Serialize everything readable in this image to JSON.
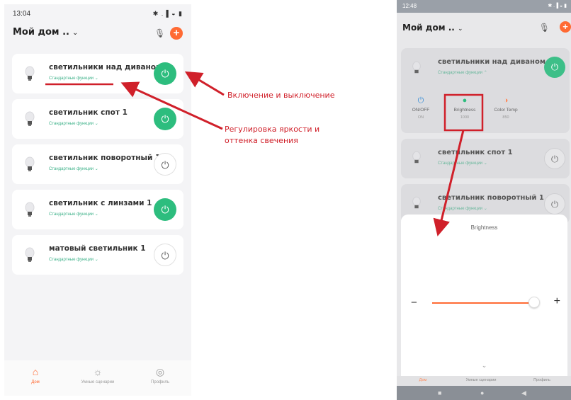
{
  "left_phone": {
    "status_time": "13:04",
    "status_icons": "✱ .▐ ◒ ▮",
    "home_title": "Мой дом ..",
    "devices": [
      {
        "name": "светильники над диваном",
        "func": "Стандартные функции ⌄",
        "state": "on"
      },
      {
        "name": "светильник спот 1",
        "func": "Стандартные функции ⌄",
        "state": "on"
      },
      {
        "name": "светильник поворотный 1",
        "func": "Стандартные функции ⌄",
        "state": "off"
      },
      {
        "name": "светильник с линзами 1",
        "func": "Стандартные функции ⌄",
        "state": "on"
      },
      {
        "name": "матовый светильник 1",
        "func": "Стандартные функции ⌄",
        "state": "off"
      }
    ],
    "tabs": [
      {
        "label": "Дом",
        "icon": "home-icon",
        "active": true
      },
      {
        "label": "Умные сценарии",
        "icon": "sun-icon",
        "active": false
      },
      {
        "label": "Профиль",
        "icon": "profile-icon",
        "active": false
      }
    ]
  },
  "annotations": {
    "power_label": "Включение и выключение",
    "brightness_label_line1": "Регулировка яркости и",
    "brightness_label_line2": "оттенка свечения"
  },
  "right_phone": {
    "status_time": "12:48",
    "status_icons": "✱ .▐ ◒ ▮",
    "home_title": "Мой дом ..",
    "devices": [
      {
        "name": "светильники над диваном",
        "func": "Стандартные функции ⌃",
        "state": "on"
      },
      {
        "name": "светильник спот 1",
        "func": "Стандартные функции ⌄",
        "state": "off"
      },
      {
        "name": "светильник поворотный 1",
        "func": "Стандартные функции ⌄",
        "state": "off"
      }
    ],
    "controls": [
      {
        "label": "ON/OFF",
        "value": "ON"
      },
      {
        "label": "Brightness",
        "value": "1000"
      },
      {
        "label": "Color Temp",
        "value": "850"
      }
    ],
    "sheet_title": "Brightness",
    "slider_level": 0.97,
    "tabs": [
      {
        "label": "Дом",
        "active": true
      },
      {
        "label": "Умные сценарии",
        "active": false
      },
      {
        "label": "Профиль",
        "active": false
      }
    ]
  },
  "colors": {
    "accent": "#ff6a33",
    "power_on": "#2dbd7e",
    "annotation": "#d0202a"
  }
}
